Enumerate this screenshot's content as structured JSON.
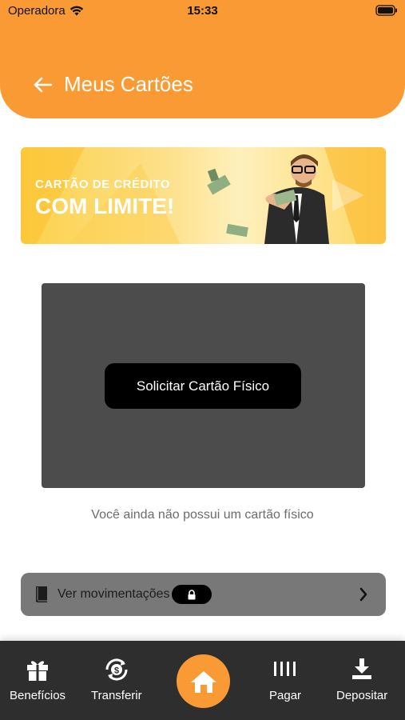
{
  "status_bar": {
    "carrier": "Operadora",
    "time": "15:33"
  },
  "header": {
    "title": "Meus Cartões"
  },
  "banner": {
    "line1": "CARTÃO DE CRÉDITO",
    "line2": "COM LIMITE!"
  },
  "card_section": {
    "request_button": "Solicitar Cartão Físico",
    "empty_message": "Você ainda não possui um cartão físico"
  },
  "movements": {
    "label": "Ver movimentações"
  },
  "tabbar": {
    "items": [
      {
        "label": "Benefícios",
        "icon": "gift-icon"
      },
      {
        "label": "Transferir",
        "icon": "transfer-icon"
      },
      {
        "label": "",
        "icon": "home-icon"
      },
      {
        "label": "Pagar",
        "icon": "barcode-icon"
      },
      {
        "label": "Depositar",
        "icon": "download-icon"
      }
    ]
  },
  "colors": {
    "accent": "#fa9a34",
    "card_placeholder": "#4c4c4c",
    "tabbar_background": "#2e2e2e",
    "movements_background": "#787878"
  }
}
